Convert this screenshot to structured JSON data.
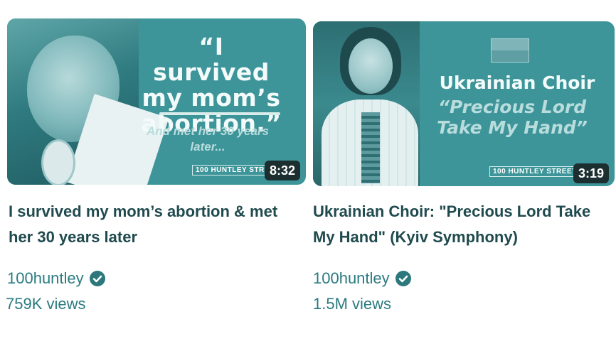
{
  "videos": [
    {
      "thumbnail": {
        "quote": "“I survived my mom’s abortion.”",
        "subtext": "And met her 30 years later...",
        "brand": "100 HUNTLEY STREET",
        "duration": "8:32"
      },
      "title": "I survived my mom’s abortion & met her 30 years later",
      "channel": "100huntley",
      "views": "759K views"
    },
    {
      "thumbnail": {
        "heading": "Ukrainian Choir",
        "subheading": "“Precious Lord Take My Hand”",
        "brand": "100 HUNTLEY STREET",
        "duration": "3:19"
      },
      "title": "Ukrainian Choir: \"Precious Lord Take My Hand\" (Kyiv Symphony)",
      "channel": "100huntley",
      "views": "1.5M views"
    }
  ],
  "colors": {
    "thumbnail_teal": "#3d9599",
    "title_text": "#1f4a4e",
    "meta_text": "#2a7b80",
    "duration_badge": "#1c2e30"
  },
  "icons": {
    "verified": "verified-check-icon"
  }
}
